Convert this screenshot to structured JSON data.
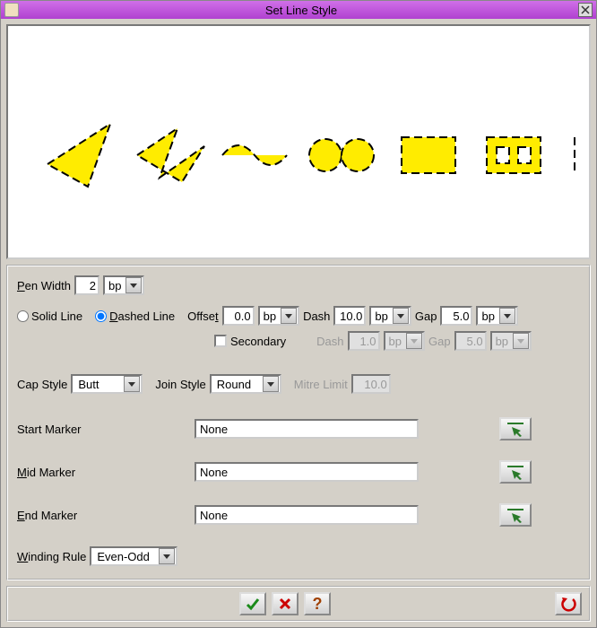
{
  "window": {
    "title": "Set Line Style"
  },
  "penWidth": {
    "label": [
      "P",
      "en Width"
    ],
    "value": "2",
    "unit": "bp"
  },
  "lineType": {
    "solid": "Solid Line",
    "dashed": [
      "D",
      "ashed Line"
    ],
    "selected": "dashed",
    "offset": {
      "label": [
        "Offse",
        "t"
      ],
      "value": "0.0",
      "unit": "bp"
    },
    "dash": {
      "label": "Dash",
      "value": "10.0",
      "unit": "bp"
    },
    "gap": {
      "label": "Gap",
      "value": "5.0",
      "unit": "bp"
    },
    "secondary": {
      "label": "Secondary",
      "checked": false,
      "dash": {
        "label": "Dash",
        "value": "1.0",
        "unit": "bp"
      },
      "gap": {
        "label": "Gap",
        "value": "5.0",
        "unit": "bp"
      }
    }
  },
  "capStyle": {
    "label": "Cap Style",
    "value": "Butt"
  },
  "joinStyle": {
    "label": "Join Style",
    "value": "Round"
  },
  "mitreLimit": {
    "label": "Mitre Limit",
    "value": "10.0"
  },
  "markers": {
    "start": {
      "label": "Start Marker",
      "value": "None"
    },
    "mid": {
      "label": [
        "M",
        "id Marker"
      ],
      "value": "None"
    },
    "end": {
      "label": [
        "E",
        "nd Marker"
      ],
      "value": "None"
    }
  },
  "windingRule": {
    "label": [
      "W",
      "inding Rule"
    ],
    "value": "Even-Odd"
  }
}
